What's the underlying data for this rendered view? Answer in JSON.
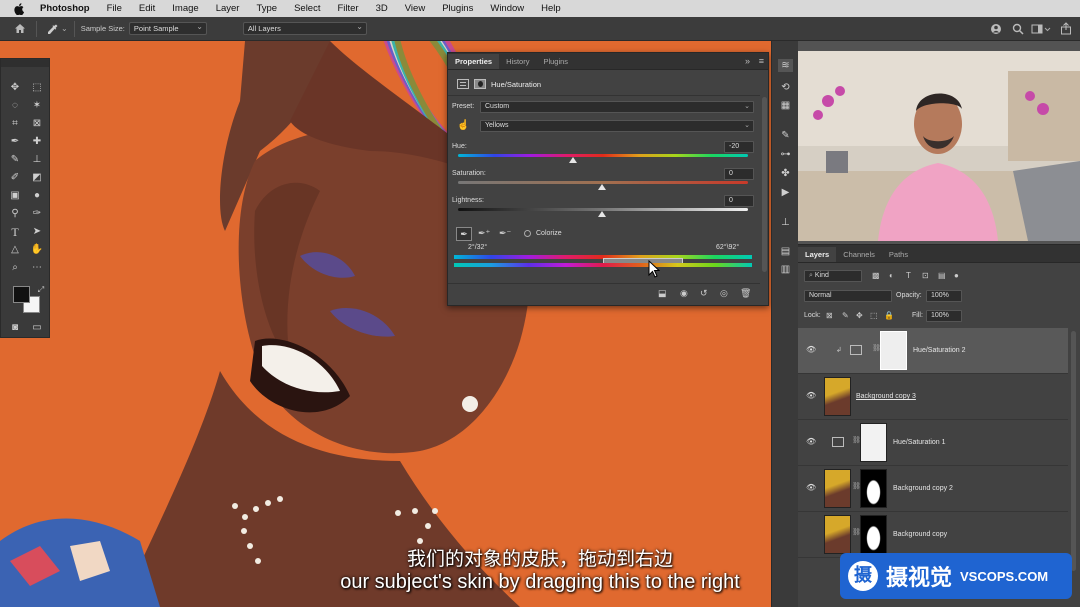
{
  "menubar": {
    "apple": "",
    "app": "Photoshop",
    "items": [
      "File",
      "Edit",
      "Image",
      "Layer",
      "Type",
      "Select",
      "Filter",
      "3D",
      "View",
      "Plugins",
      "Window",
      "Help"
    ]
  },
  "options_bar": {
    "sample_size_label": "Sample Size:",
    "sample_size_value": "Point Sample",
    "sample_layers_value": "All Layers"
  },
  "properties": {
    "tabs": [
      "Properties",
      "History",
      "Plugins"
    ],
    "adjustment_title": "Hue/Saturation",
    "preset_label": "Preset:",
    "preset_value": "Custom",
    "channel_value": "Yellows",
    "hue_label": "Hue:",
    "hue_value": "-20",
    "saturation_label": "Saturation:",
    "saturation_value": "0",
    "lightness_label": "Lightness:",
    "lightness_value": "0",
    "colorize_label": "Colorize",
    "range_left": "2°/32°",
    "range_right": "62°\\92°",
    "hue_level": -20,
    "saturation_level": 0,
    "lightness_level": 0
  },
  "layers_panel": {
    "tabs": [
      "Layers",
      "Channels",
      "Paths"
    ],
    "filter_kind": "Kind",
    "blend_mode": "Normal",
    "opacity_label": "Opacity:",
    "opacity_value": "100%",
    "lock_label": "Lock:",
    "fill_label": "Fill:",
    "fill_value": "100%",
    "layers": [
      {
        "name": "Hue/Saturation 2"
      },
      {
        "name": "Background copy 3"
      },
      {
        "name": "Hue/Saturation 1"
      },
      {
        "name": "Background copy 2"
      },
      {
        "name": "Background copy"
      }
    ]
  },
  "subtitles": {
    "chinese": "我们的对象的皮肤，拖动到右边",
    "english": "our subject's skin by dragging this to the right"
  },
  "watermark": {
    "cn": "摄视觉",
    "en": "VSCOPS.COM",
    "glyph": "摄"
  },
  "colors": {
    "canvas_bg": "#e0692f",
    "panel_bg": "#424242",
    "watermark_blue": "#1f64d1"
  }
}
